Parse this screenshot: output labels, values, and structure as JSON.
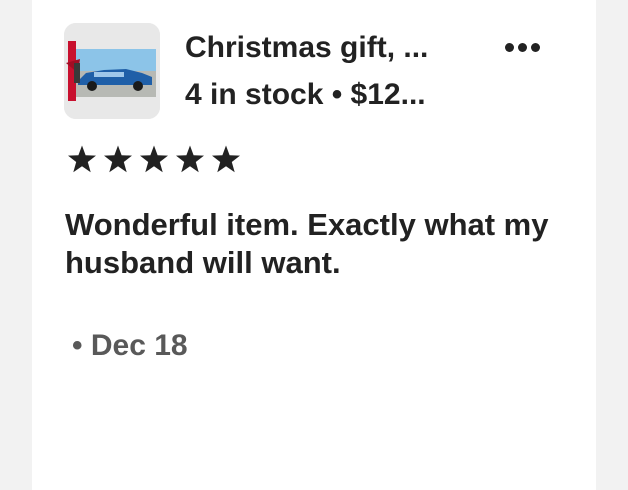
{
  "listing": {
    "title": "Christmas gift, ...",
    "subtitle": "4 in stock • $12...",
    "image_icon": "product-thumbnail-car-canvas"
  },
  "menu": {
    "icon": "more-horizontal-icon"
  },
  "review": {
    "rating": 5,
    "rating_max": 5,
    "text": "Wonderful item. Exactly what my husband will want.",
    "date": "• Dec 18"
  },
  "colors": {
    "text": "#222222",
    "muted": "#595959",
    "card": "#ffffff",
    "background": "#f2f2f2"
  }
}
